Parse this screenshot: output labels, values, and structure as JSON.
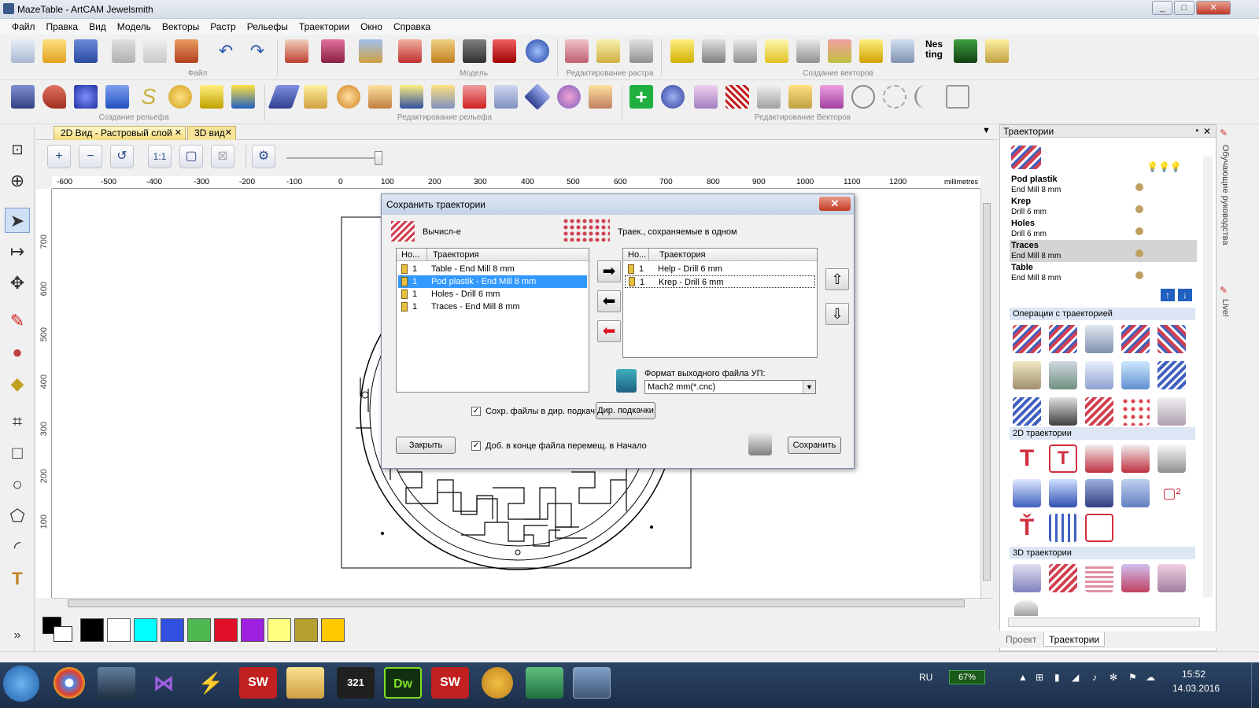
{
  "window": {
    "title": "MazeTable - ArtCAM Jewelsmith",
    "min": "_",
    "max": "□",
    "close": "✕"
  },
  "menu": [
    "Файл",
    "Правка",
    "Вид",
    "Модель",
    "Векторы",
    "Растр",
    "Рельефы",
    "Траектории",
    "Окно",
    "Справка"
  ],
  "toolbar_groups": {
    "file": "Файл",
    "model": "Модель",
    "raster_edit": "Редактирование растра",
    "vector_create": "Создание векторов",
    "relief_create": "Создание рельефа",
    "relief_edit": "Редактирование рельефа",
    "vector_edit": "Редактирование Векторов"
  },
  "nesting_label": "Nes\nting",
  "doc_tabs": [
    {
      "label": "2D Вид - Растровый слой",
      "close": "✕"
    },
    {
      "label": "3D вид",
      "close": "✕"
    }
  ],
  "ruler": {
    "units": "millimetres",
    "x_ticks": [
      "-600",
      "-500",
      "-400",
      "-300",
      "-200",
      "-100",
      "0",
      "100",
      "200",
      "300",
      "400",
      "500",
      "600",
      "700",
      "800",
      "900",
      "1000",
      "1100",
      "1200"
    ],
    "y_ticks": [
      "700",
      "600",
      "500",
      "400",
      "300",
      "200",
      "100"
    ]
  },
  "palette": {
    "colors": [
      "#000000",
      "#ffffff",
      "#00ffff",
      "#3050e0",
      "#50b850",
      "#e01028",
      "#a020e0",
      "#ffff80",
      "#b8a030",
      "#ffc800"
    ]
  },
  "right_panel": {
    "title": "Траектории",
    "toolpaths": [
      {
        "name": "Pod plastik",
        "tool": "End Mill 8 mm"
      },
      {
        "name": "Krep",
        "tool": "Drill 6 mm"
      },
      {
        "name": "Holes",
        "tool": "Drill 6 mm"
      },
      {
        "name": "Traces",
        "tool": "End Mill 8 mm"
      },
      {
        "name": "Table",
        "tool": "End Mill 8 mm"
      }
    ],
    "sections": [
      "Операции с траекторией",
      "2D траектории",
      "3D траектории"
    ],
    "bottom_tabs": [
      "Проект",
      "Траектории"
    ]
  },
  "side_tabs": [
    "Обучающие руководства",
    "Live!"
  ],
  "dialog": {
    "title": "Сохранить траектории",
    "computed_label": "Вычисл-е",
    "saved_label": "Траек., сохраняемые в одном",
    "col_no": "Но...",
    "col_path": "Траектория",
    "left_rows": [
      {
        "no": "1",
        "name": "Table - End Mill 8 mm"
      },
      {
        "no": "1",
        "name": "Pod plastik - End Mill 8 mm"
      },
      {
        "no": "1",
        "name": "Holes - Drill 6 mm"
      },
      {
        "no": "1",
        "name": "Traces - End Mill 8 mm"
      }
    ],
    "right_rows": [
      {
        "no": "1",
        "name": "Help - Drill 6 mm"
      },
      {
        "no": "1",
        "name": "Krep - Drill 6 mm"
      }
    ],
    "format_label": "Формат выходного файла УП:",
    "format_value": "Mach2 mm(*.cnc)",
    "save_in_dir_label": "Сохр. файлы в дир. подкач",
    "dir_button": "Дир. подкачки",
    "append_label": "Доб. в конце файла перемещ. в Начало",
    "close_button": "Закрыть",
    "save_button": "Сохранить",
    "check": "✓"
  },
  "taskbar": {
    "lang": "RU",
    "battery": "67%",
    "time": "15:52",
    "date": "14.03.2016",
    "apps": [
      "SW",
      "Dw",
      "SW",
      "321"
    ]
  }
}
